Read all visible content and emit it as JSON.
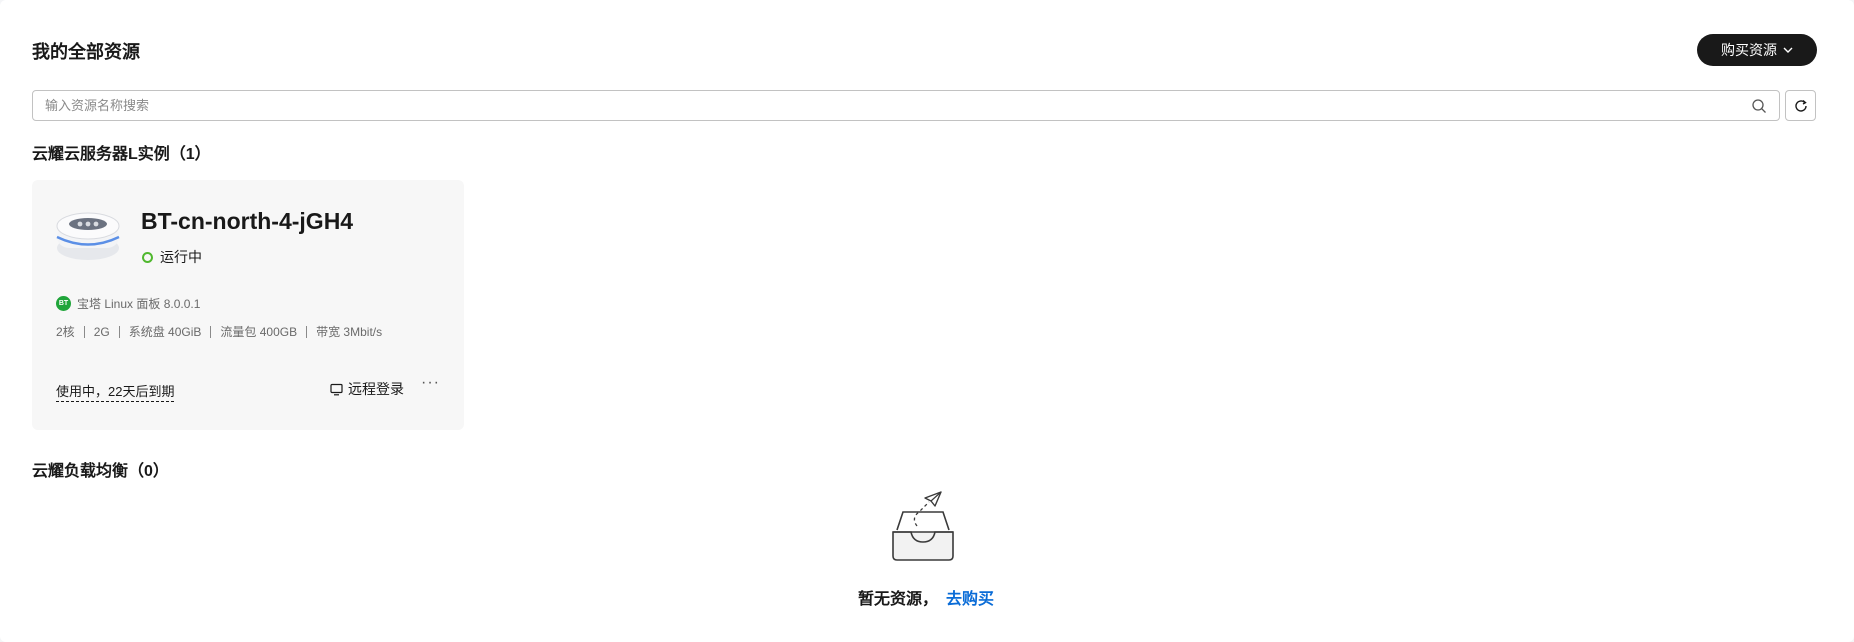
{
  "header": {
    "title": "我的全部资源",
    "buy_button_label": "购买资源"
  },
  "search": {
    "placeholder": "输入资源名称搜索",
    "value": ""
  },
  "sections": [
    {
      "title": "云耀云服务器L实例（1）"
    },
    {
      "title": "云耀负载均衡（0）"
    }
  ],
  "instance": {
    "name": "BT-cn-north-4-jGH4",
    "status": "运行中",
    "image_badge": "BT",
    "image": "宝塔 Linux 面板 8.0.0.1",
    "specs": [
      "2核",
      "2G",
      "系统盘 40GiB",
      "流量包 400GB",
      "带宽 3Mbit/s"
    ],
    "expiry": "使用中，22天后到期",
    "remote_login": "远程登录",
    "more": "···"
  },
  "empty_state": {
    "text": "暂无资源，",
    "link": "去购买"
  },
  "colors": {
    "primary_button": "#191919",
    "status_running": "#50b82e",
    "link": "#0a6cd7",
    "bt_badge": "#20a53a"
  },
  "icons": {
    "search": "search-icon",
    "refresh": "refresh-icon",
    "chevron": "chevron-down-icon",
    "monitor": "monitor-icon",
    "server": "server-icon",
    "empty": "empty-box-icon"
  }
}
